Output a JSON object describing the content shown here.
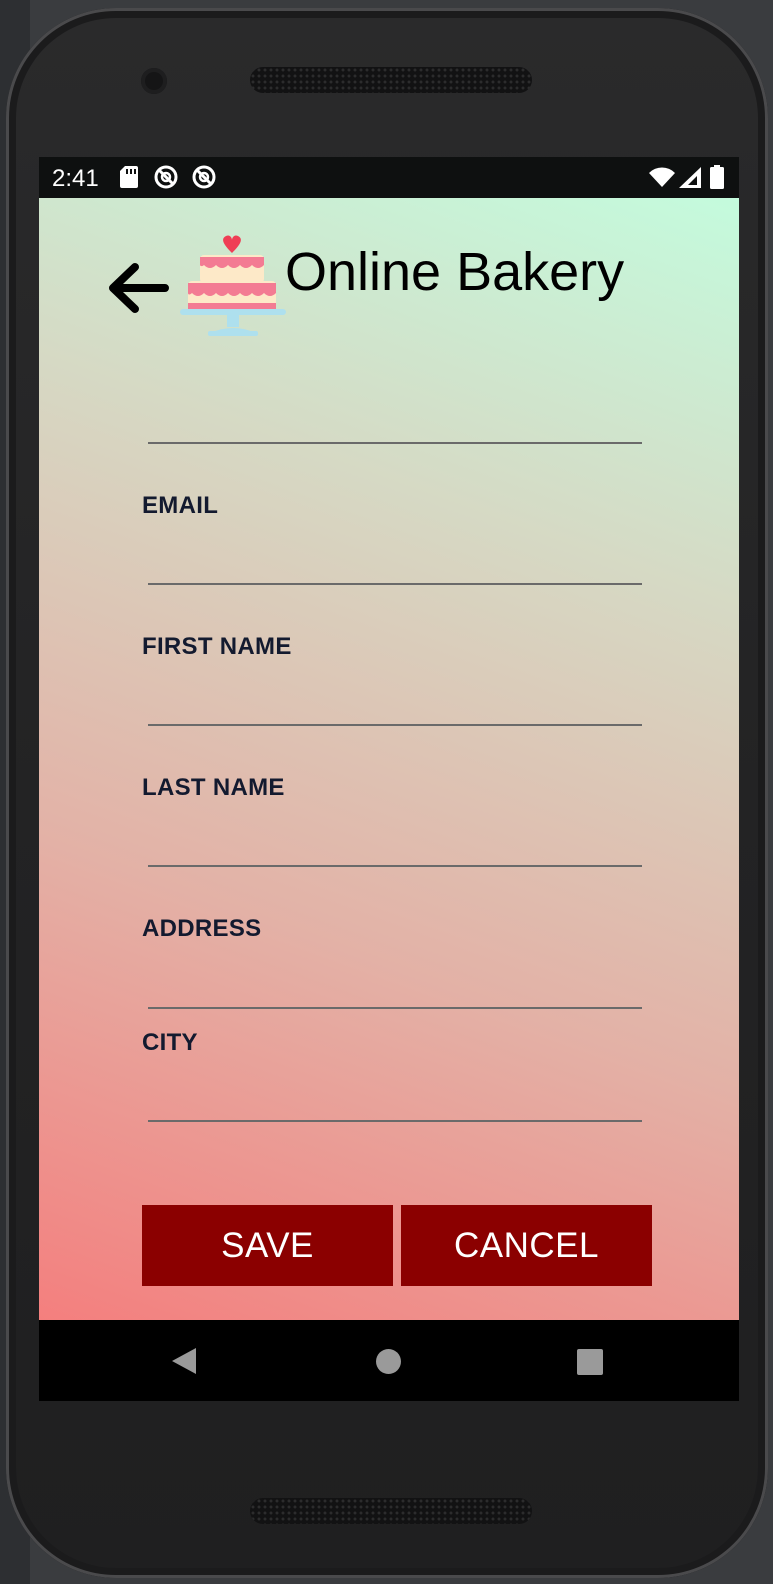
{
  "status_bar": {
    "time": "2:41",
    "left_icons": [
      "sd-card-icon",
      "sync-blocked-icon",
      "sync-blocked-icon"
    ],
    "right_icons": [
      "wifi-icon",
      "cell-signal-icon",
      "battery-icon"
    ]
  },
  "header": {
    "back_icon": "arrow-left-icon",
    "logo_icon": "cake-icon",
    "title": "Online Bakery"
  },
  "form": {
    "fields": [
      {
        "label": "",
        "value": ""
      },
      {
        "label": "EMAIL",
        "value": ""
      },
      {
        "label": "FIRST NAME",
        "value": ""
      },
      {
        "label": "LAST NAME",
        "value": ""
      },
      {
        "label": "ADDRESS",
        "value": ""
      },
      {
        "label": "CITY",
        "value": ""
      }
    ]
  },
  "actions": {
    "save_label": "SAVE",
    "cancel_label": "CANCEL"
  },
  "nav_bar": {
    "icons": [
      "nav-back-icon",
      "nav-home-icon",
      "nav-recents-icon"
    ]
  },
  "colors": {
    "button": "#8b0000",
    "label": "#131a2f",
    "gradient_top_right": "#c4fbdd",
    "gradient_bottom_left": "#f47f7e"
  }
}
